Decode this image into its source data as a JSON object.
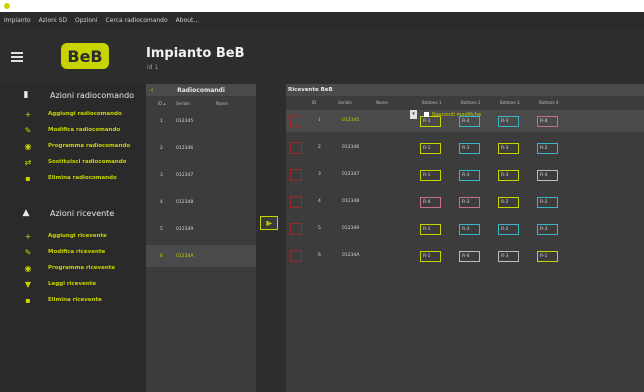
{
  "menu": [
    "Impianto",
    "Azioni SD",
    "Opzioni",
    "Cerca radiocomando",
    "About..."
  ],
  "header": {
    "title": "Impianto BeB",
    "subtitle": "id 1",
    "brand_text": "BeB"
  },
  "sidebar": {
    "section1": {
      "title": "Azioni radiocomando",
      "icon": "remote-icon"
    },
    "items1": [
      {
        "label": "Aggiungi radiocomando",
        "icon": "plus-icon"
      },
      {
        "label": "Modifica radiocomando",
        "icon": "pencil-icon"
      },
      {
        "label": "Programma radiocomando",
        "icon": "program-icon"
      },
      {
        "label": "Sostituisci radiocomando",
        "icon": "swap-icon"
      },
      {
        "label": "Elimina radiocomando",
        "icon": "trash-icon"
      }
    ],
    "section2": {
      "title": "Azioni ricevente",
      "icon": "receiver-icon"
    },
    "items2": [
      {
        "label": "Aggiungi ricevente",
        "icon": "plus-icon"
      },
      {
        "label": "Modifica ricevente",
        "icon": "pencil-icon"
      },
      {
        "label": "Programma ricevente",
        "icon": "program-icon"
      },
      {
        "label": "Leggi ricevente",
        "icon": "read-icon"
      },
      {
        "label": "Elimina ricevente",
        "icon": "trash-icon"
      }
    ]
  },
  "left_panel": {
    "title": "Radiocomandi",
    "columns": [
      "ID",
      "Seriale",
      "Nome"
    ],
    "rows": [
      {
        "id": "1",
        "serial": "012345",
        "name": "",
        "selected": false
      },
      {
        "id": "2",
        "serial": "012346",
        "name": "",
        "selected": false
      },
      {
        "id": "3",
        "serial": "012347",
        "name": "",
        "selected": false
      },
      {
        "id": "4",
        "serial": "012348",
        "name": "",
        "selected": false
      },
      {
        "id": "5",
        "serial": "012349",
        "name": "",
        "selected": false
      },
      {
        "id": "6",
        "serial": "01234A",
        "name": "",
        "selected": true
      }
    ]
  },
  "right_panel": {
    "title": "Ricevente BeB",
    "hide_label": "Nascondi modifiche",
    "columns": [
      "ID",
      "Seriale",
      "Nome",
      "Bottone 1",
      "Bottone 2",
      "Bottone 3",
      "Bottone 4"
    ],
    "rows": [
      {
        "id": "1",
        "serial": "012345",
        "selected": true,
        "buttons": [
          {
            "label": "R-1",
            "color": "yellow"
          },
          {
            "label": "R-2",
            "color": "cyan"
          },
          {
            "label": "R-3",
            "color": "cyan"
          },
          {
            "label": "R-4",
            "color": "pink"
          }
        ]
      },
      {
        "id": "2",
        "serial": "012346",
        "selected": false,
        "buttons": [
          {
            "label": "R-1",
            "color": "yellow"
          },
          {
            "label": "R-3",
            "color": "cyan"
          },
          {
            "label": "R-3",
            "color": "yellow"
          },
          {
            "label": "R-2",
            "color": "cyan"
          }
        ]
      },
      {
        "id": "3",
        "serial": "012347",
        "selected": false,
        "buttons": [
          {
            "label": "R-1",
            "color": "yellow"
          },
          {
            "label": "R-3",
            "color": "cyan"
          },
          {
            "label": "R-3",
            "color": "yellow"
          },
          {
            "label": "R-4",
            "color": "white"
          }
        ]
      },
      {
        "id": "4",
        "serial": "012348",
        "selected": false,
        "buttons": [
          {
            "label": "R-4",
            "color": "pink"
          },
          {
            "label": "R-3",
            "color": "pink"
          },
          {
            "label": "R-2",
            "color": "yellow"
          },
          {
            "label": "R-2",
            "color": "cyan"
          }
        ]
      },
      {
        "id": "5",
        "serial": "012349",
        "selected": false,
        "buttons": [
          {
            "label": "R-1",
            "color": "yellow"
          },
          {
            "label": "R-3",
            "color": "cyan"
          },
          {
            "label": "R-2",
            "color": "cyan"
          },
          {
            "label": "R-3",
            "color": "cyan"
          }
        ]
      },
      {
        "id": "6",
        "serial": "01234A",
        "selected": false,
        "buttons": [
          {
            "label": "R-1",
            "color": "yellow"
          },
          {
            "label": "R-4",
            "color": "white"
          },
          {
            "label": "R-3",
            "color": "white"
          },
          {
            "label": "R-1",
            "color": "yellow"
          }
        ]
      }
    ]
  },
  "colors": {
    "accent": "#c8d400",
    "cyan": "#3ab5c8",
    "pink": "#c8708a",
    "bg": "#333333"
  }
}
